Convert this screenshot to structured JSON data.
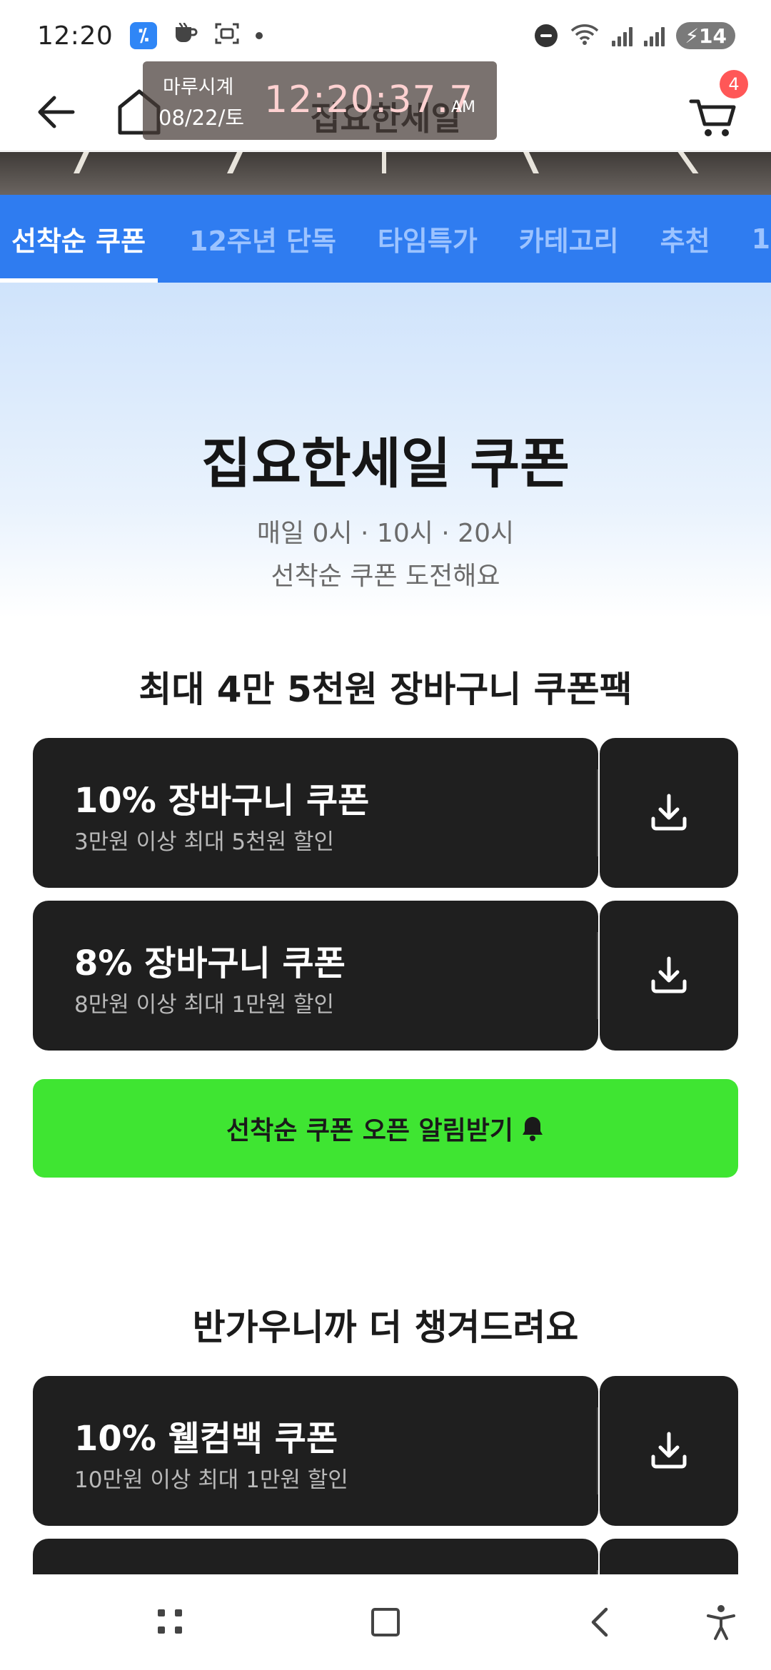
{
  "status_bar": {
    "time": "12:20",
    "app_icon_glyph": "⁒",
    "battery_level": "14",
    "icons": [
      "app-icon",
      "cup-icon",
      "screenshot-icon",
      "dot-icon",
      "dnd-icon",
      "wifi-icon",
      "signal-icon",
      "battery-icon"
    ]
  },
  "header": {
    "title": "집요한세일",
    "cart_count": "4"
  },
  "clock_overlay": {
    "name": "마루시계",
    "date": "08/22/토",
    "time": "12:20:37.7",
    "ampm": "AM"
  },
  "tabs": [
    {
      "label": "선착순 쿠폰",
      "active": true
    },
    {
      "label": "12주년 단독",
      "active": false
    },
    {
      "label": "타임특가",
      "active": false
    },
    {
      "label": "카테고리",
      "active": false
    },
    {
      "label": "추천",
      "active": false
    },
    {
      "label": "1",
      "active": false
    }
  ],
  "hero": {
    "title": "집요한세일 쿠폰",
    "subtitle_line1": "매일 0시 · 10시 · 20시",
    "subtitle_line2": "선착순 쿠폰 도전해요"
  },
  "cart_pack": {
    "title": "최대 4만 5천원 장바구니 쿠폰팩",
    "coupons": [
      {
        "name": "10% 장바구니 쿠폰",
        "desc": "3만원 이상 최대 5천원 할인"
      },
      {
        "name": "8% 장바구니 쿠폰",
        "desc": "8만원 이상 최대 1만원 할인"
      }
    ]
  },
  "notify_button": {
    "label": "선착순 쿠폰 오픈 알림받기"
  },
  "welcome": {
    "title": "반가우니까 더 챙겨드려요",
    "coupons": [
      {
        "name": "10% 웰컴백 쿠폰",
        "desc": "10만원 이상 최대 1만원 할인"
      }
    ]
  },
  "colors": {
    "tab_bar": "#2f7cf0",
    "coupon_card": "#1f1f1f",
    "notify_button": "#3fe532",
    "cart_badge": "#ff5757"
  }
}
